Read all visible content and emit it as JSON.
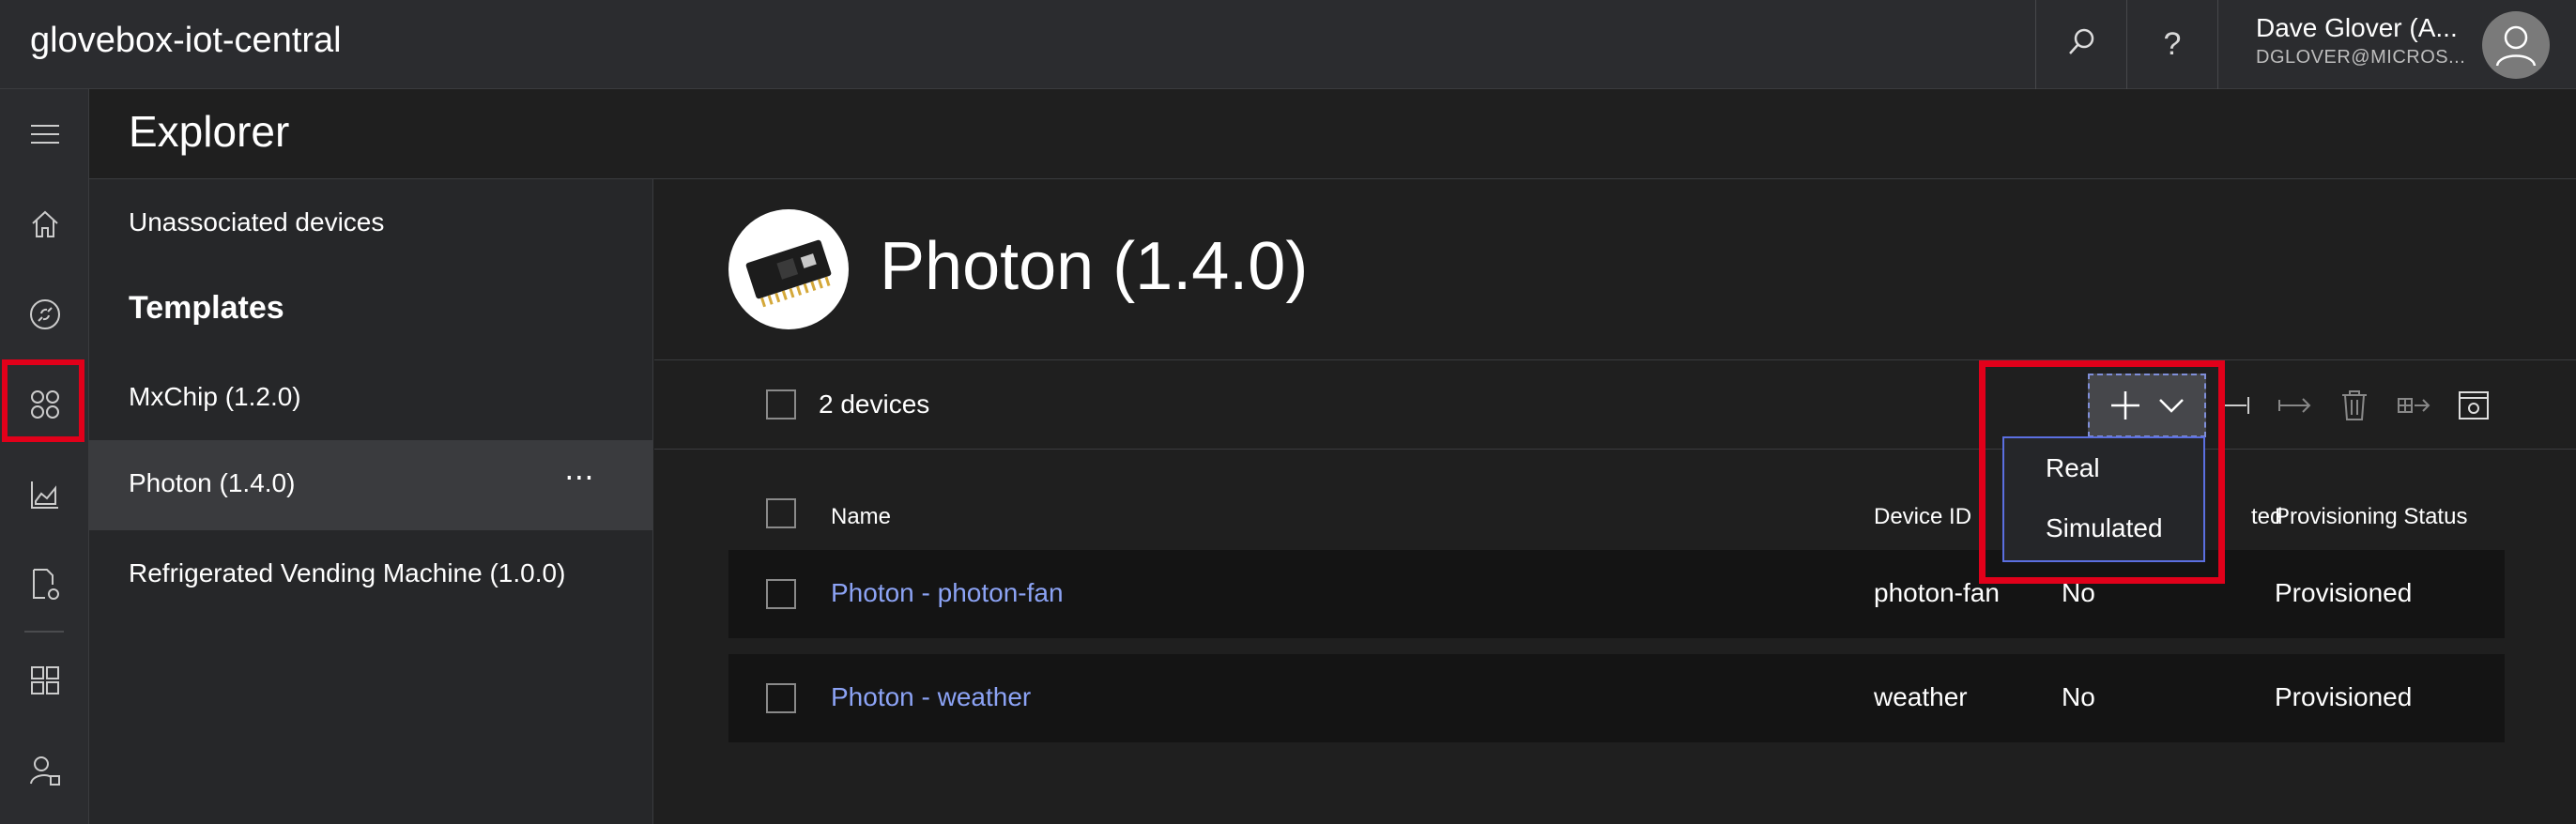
{
  "app": {
    "title": "glovebox-iot-central"
  },
  "user": {
    "name": "Dave Glover (A...",
    "email": "DGLOVER@MICROS..."
  },
  "page": {
    "title": "Explorer"
  },
  "explorer": {
    "unassociated": "Unassociated devices",
    "templates_heading": "Templates",
    "templates": [
      "MxChip (1.2.0)",
      "Photon (1.4.0)",
      "Refrigerated Vending Machine (1.0.0)"
    ],
    "more_label": "⋯"
  },
  "template": {
    "title": "Photon (1.4.0)"
  },
  "toolbar": {
    "device_count": "2 devices"
  },
  "dropdown": {
    "items": [
      "Real",
      "Simulated"
    ]
  },
  "table": {
    "columns": [
      "Name",
      "Device ID",
      "ted",
      "Provisioning Status"
    ],
    "rows": [
      {
        "name": "Photon - photon-fan",
        "device_id": "photon-fan",
        "simulated": "No",
        "status": "Provisioned"
      },
      {
        "name": "Photon - weather",
        "device_id": "weather",
        "simulated": "No",
        "status": "Provisioned"
      }
    ]
  },
  "icons": {
    "rail": [
      "hamburger-icon",
      "home-icon",
      "device-explorer-icon",
      "device-sets-icon",
      "analytics-icon",
      "jobs-icon",
      "dashboard-icon",
      "administration-icon"
    ],
    "toolbar": [
      "add-icon",
      "chevron-down-icon",
      "block-icon",
      "migrate-icon",
      "delete-icon",
      "export-icon",
      "settings-icon"
    ]
  },
  "colors": {
    "highlight": "#e1001a",
    "link": "#8ca3f5",
    "accent": "#5b6fe0"
  }
}
